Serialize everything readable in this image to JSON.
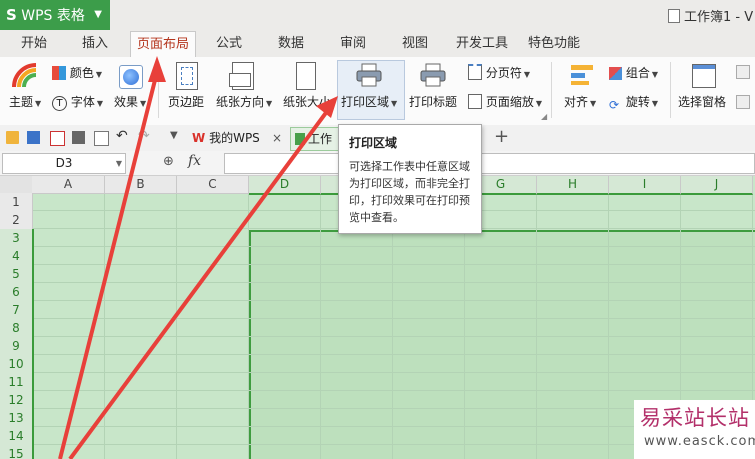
{
  "titlebar": {
    "app_label": "WPS 表格",
    "document_title": "工作簿1 - V"
  },
  "tabs": [
    "开始",
    "插入",
    "页面布局",
    "公式",
    "数据",
    "审阅",
    "视图",
    "开发工具",
    "特色功能"
  ],
  "active_tab": "页面布局",
  "ribbon": {
    "theme": "主题",
    "colors": "颜色",
    "fonts": "字体",
    "effects": "效果",
    "margins": "页边距",
    "orientation": "纸张方向",
    "paper_size": "纸张大小",
    "print_area": "打印区域",
    "print_titles": "打印标题",
    "page_break": "分页符",
    "page_zoom": "页面缩放",
    "align": "对齐",
    "group": "组合",
    "rotate": "旋转",
    "selection_pane": "选择窗格"
  },
  "doc_tabs": {
    "wps_home": "我的WPS",
    "workbook_partial": "工作"
  },
  "formula_bar": {
    "name_box": "D3",
    "fx": "fx",
    "formula_value": ""
  },
  "sheet": {
    "columns": [
      "A",
      "B",
      "C",
      "D",
      "E",
      "F",
      "G",
      "H",
      "I",
      "J"
    ],
    "rows": [
      "1",
      "2",
      "3",
      "4",
      "5",
      "6",
      "7",
      "8",
      "9",
      "10",
      "11",
      "12",
      "13",
      "14",
      "15"
    ]
  },
  "tooltip": {
    "title": "打印区域",
    "body": "可选择工作表中任意区域为打印区域，而非完全打印，打印效果可在打印预览中查看。"
  },
  "watermark": {
    "text_cn": "易采站长站",
    "url": "www.easck.com"
  },
  "colors": {
    "app_green": "#3c9d4a",
    "active_tab_text": "#b4351d",
    "selection_green": "#3e9c3f",
    "grid_fill": "#c8e6c9",
    "arrow_red": "#e8403a"
  }
}
